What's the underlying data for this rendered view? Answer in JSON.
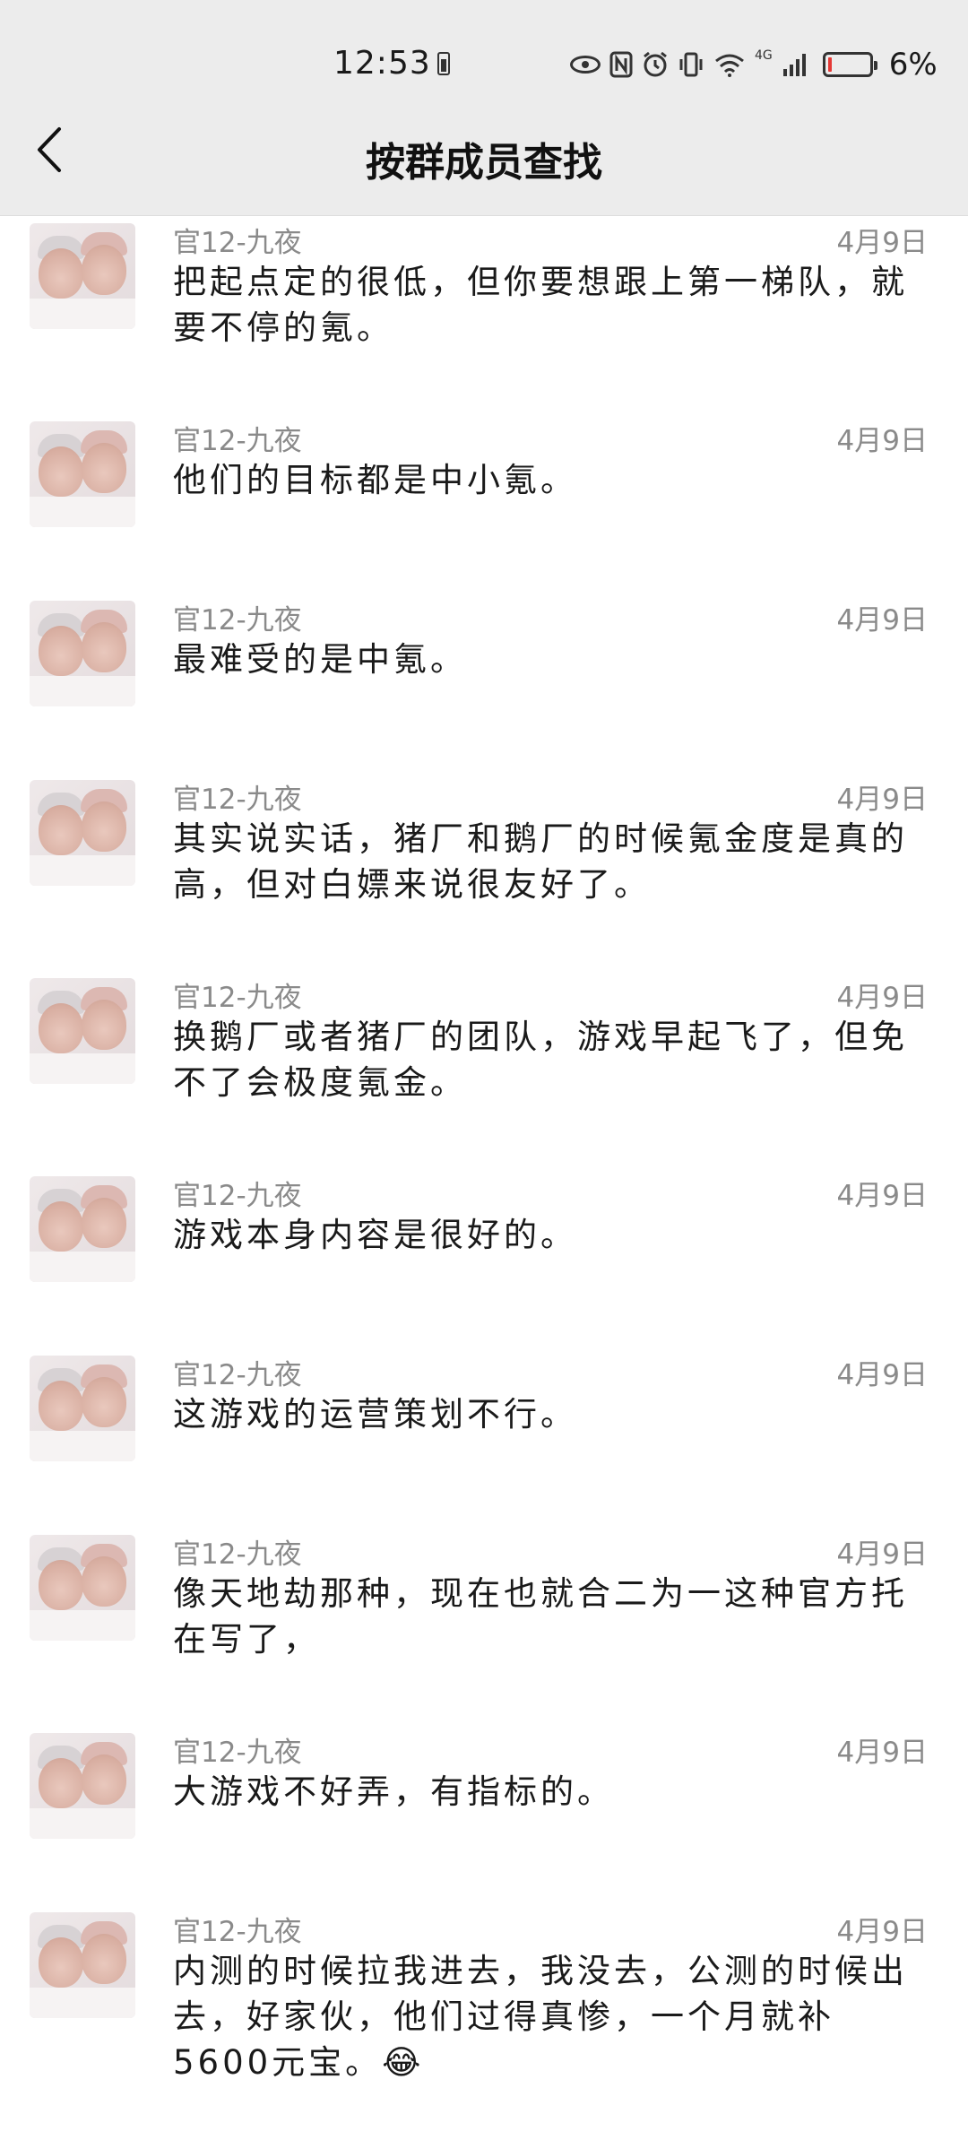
{
  "status_bar": {
    "time": "12:53",
    "network_label": "4G",
    "battery_percent": "6%",
    "battery_level": 0.06,
    "icons": [
      "battery-saver-icon",
      "eye-icon",
      "nfc-icon",
      "alarm-icon",
      "vibrate-icon",
      "wifi-icon",
      "signal-icon",
      "battery-icon"
    ]
  },
  "header": {
    "title": "按群成员查找",
    "back_icon": "chevron-left-icon"
  },
  "messages": [
    {
      "sender": "官12-九夜",
      "date": "4月9日",
      "text": "把起点定的很低，但你要想跟上第一梯队，就要不停的氪。"
    },
    {
      "sender": "官12-九夜",
      "date": "4月9日",
      "text": "他们的目标都是中小氪。"
    },
    {
      "sender": "官12-九夜",
      "date": "4月9日",
      "text": "最难受的是中氪。"
    },
    {
      "sender": "官12-九夜",
      "date": "4月9日",
      "text": "其实说实话，猪厂和鹅厂的时候氪金度是真的高，但对白嫖来说很友好了。"
    },
    {
      "sender": "官12-九夜",
      "date": "4月9日",
      "text": "换鹅厂或者猪厂的团队，游戏早起飞了，但免不了会极度氪金。"
    },
    {
      "sender": "官12-九夜",
      "date": "4月9日",
      "text": "游戏本身内容是很好的。"
    },
    {
      "sender": "官12-九夜",
      "date": "4月9日",
      "text": "这游戏的运营策划不行。"
    },
    {
      "sender": "官12-九夜",
      "date": "4月9日",
      "text": "像天地劫那种，现在也就合二为一这种官方托在写了，"
    },
    {
      "sender": "官12-九夜",
      "date": "4月9日",
      "text": "大游戏不好弄，有指标的。"
    },
    {
      "sender": "官12-九夜",
      "date": "4月9日",
      "text": "内测的时候拉我进去，我没去，公测的时候出去，好家伙，他们过得真惨，一个月就补5600元宝。😂"
    }
  ]
}
